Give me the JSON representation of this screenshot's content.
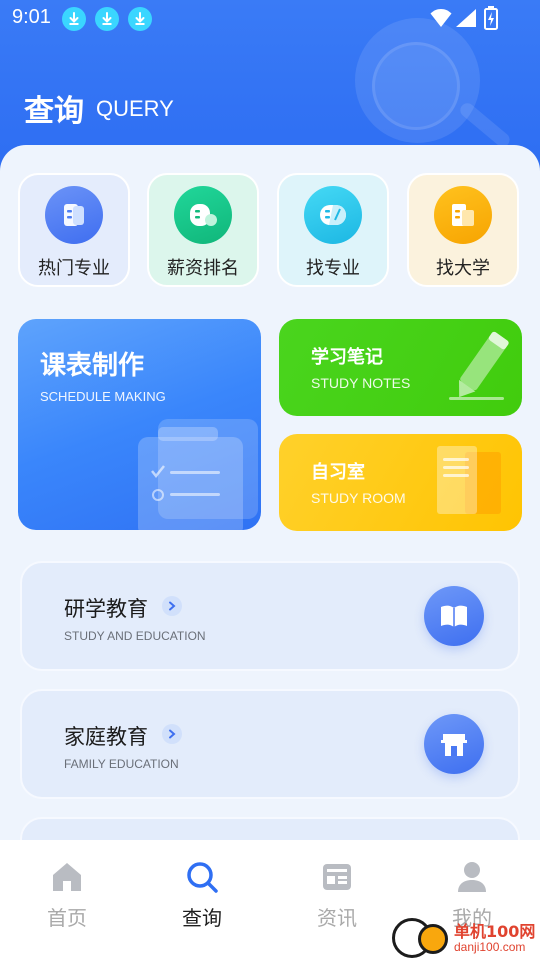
{
  "status_bar": {
    "time": "9:01",
    "notification_icons": [
      "download-icon",
      "download-icon",
      "download-icon"
    ],
    "system_icons": [
      "wifi-icon",
      "signal-icon",
      "battery-icon"
    ]
  },
  "header": {
    "title": "查询",
    "subtitle": "QUERY"
  },
  "quick_tiles": [
    {
      "label": "热门专业",
      "icon": "book-icon",
      "color": "#4f7ff4"
    },
    {
      "label": "薪资排名",
      "icon": "money-icon",
      "color": "#16c585"
    },
    {
      "label": "找专业",
      "icon": "capsule-icon",
      "color": "#2cc6ee"
    },
    {
      "label": "找大学",
      "icon": "school-icon",
      "color": "#fbb10a"
    }
  ],
  "feature_cards": {
    "schedule": {
      "title": "课表制作",
      "subtitle": "SCHEDULE MAKING"
    },
    "notes": {
      "title": "学习笔记",
      "subtitle": "STUDY NOTES"
    },
    "room": {
      "title": "自习室",
      "subtitle": "STUDY ROOM"
    }
  },
  "list_cards": [
    {
      "title": "研学教育",
      "subtitle": "STUDY AND EDUCATION",
      "icon": "open-book-icon"
    },
    {
      "title": "家庭教育",
      "subtitle": "FAMILY EDUCATION",
      "icon": "house-icon"
    }
  ],
  "bottom_nav": {
    "items": [
      {
        "label": "首页",
        "icon": "home-icon",
        "active": false
      },
      {
        "label": "查询",
        "icon": "search-icon",
        "active": true
      },
      {
        "label": "资讯",
        "icon": "news-icon",
        "active": false
      },
      {
        "label": "我的",
        "icon": "user-icon",
        "active": false
      }
    ]
  },
  "watermark": {
    "line1": "单机100网",
    "line2": "danji100.com"
  },
  "colors": {
    "primary": "#2f6ff3",
    "accent_green": "#41cc0d",
    "accent_yellow": "#ffc402",
    "nav_active": "#2f6ff3",
    "nav_inactive": "#a9a9a9"
  }
}
